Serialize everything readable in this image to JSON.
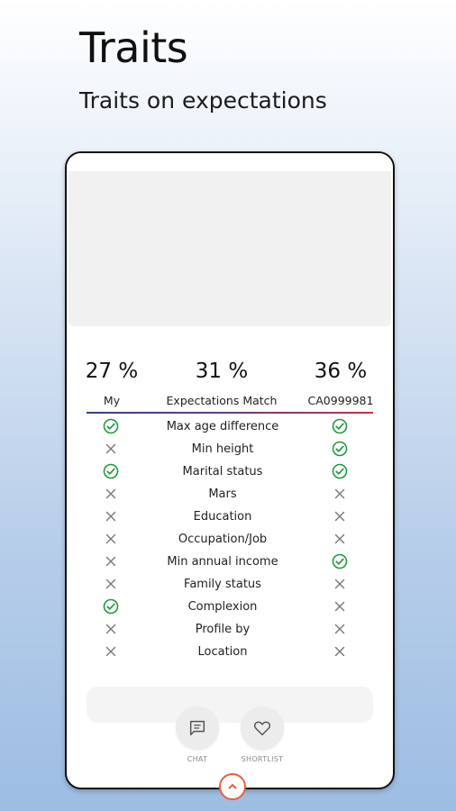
{
  "header": {
    "title": "Traits",
    "subtitle": "Traits on expectations"
  },
  "stats": {
    "my": {
      "value": "27 %",
      "label": "My"
    },
    "match": {
      "value": "31 %",
      "label": "Expectations Match"
    },
    "partner": {
      "value": "36 %",
      "label": "CA0999981"
    }
  },
  "traits": [
    {
      "label": "Max age difference",
      "my": "check",
      "partner": "check"
    },
    {
      "label": "Min height",
      "my": "cross",
      "partner": "check"
    },
    {
      "label": "Marital status",
      "my": "check",
      "partner": "check"
    },
    {
      "label": "Mars",
      "my": "cross",
      "partner": "cross"
    },
    {
      "label": "Education",
      "my": "cross",
      "partner": "cross"
    },
    {
      "label": "Occupation/Job",
      "my": "cross",
      "partner": "cross"
    },
    {
      "label": "Min annual income",
      "my": "cross",
      "partner": "check"
    },
    {
      "label": "Family status",
      "my": "cross",
      "partner": "cross"
    },
    {
      "label": "Complexion",
      "my": "check",
      "partner": "cross"
    },
    {
      "label": "Profile by",
      "my": "cross",
      "partner": "cross"
    },
    {
      "label": "Location",
      "my": "cross",
      "partner": "cross"
    }
  ],
  "actions": {
    "chat_label": "CHAT",
    "shortlist_label": "SHORTLIST"
  },
  "colors": {
    "check": "#1f9a3a",
    "cross": "#777777",
    "accent": "#e8603c"
  }
}
